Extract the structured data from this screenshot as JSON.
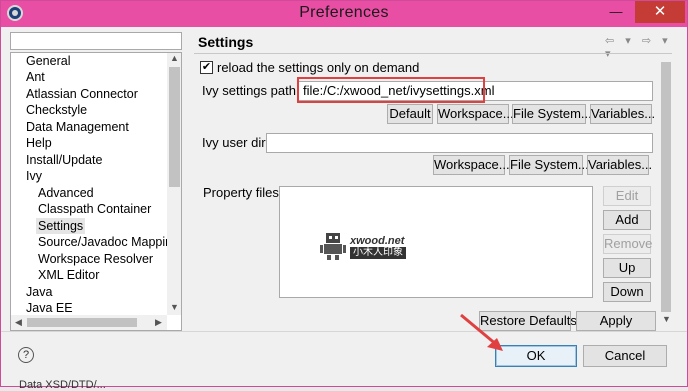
{
  "window": {
    "title": "Preferences"
  },
  "titlebar": {
    "minimize": "—",
    "close": "✕"
  },
  "tree": {
    "items": [
      {
        "label": "General",
        "selected": false
      },
      {
        "label": "Ant",
        "selected": false
      },
      {
        "label": "Atlassian Connector",
        "selected": false
      },
      {
        "label": "Checkstyle",
        "selected": false
      },
      {
        "label": "Data Management",
        "selected": false
      },
      {
        "label": "Help",
        "selected": false
      },
      {
        "label": "Install/Update",
        "selected": false
      },
      {
        "label": "Ivy",
        "selected": false
      },
      {
        "label": "Advanced",
        "selected": false
      },
      {
        "label": "Classpath Container",
        "selected": false
      },
      {
        "label": "Settings",
        "selected": true
      },
      {
        "label": "Source/Javadoc Mapping",
        "selected": false
      },
      {
        "label": "Workspace Resolver",
        "selected": false
      },
      {
        "label": "XML Editor",
        "selected": false
      },
      {
        "label": "Java",
        "selected": false
      },
      {
        "label": "Java EE",
        "selected": false
      }
    ]
  },
  "page": {
    "title": "Settings",
    "nav_arrows": "⇦ ▾ ⇨ ▾ ▾",
    "reload_checkbox": {
      "checked": true,
      "mark": "✔",
      "label": "reload the settings only on demand"
    },
    "ivy_settings_path": {
      "label": "Ivy settings path:",
      "value": "file:/C:/xwood_net/ivysettings.xml"
    },
    "settings_buttons": {
      "default": "Default",
      "workspace": "Workspace...",
      "file_system": "File System...",
      "variables": "Variables..."
    },
    "ivy_user_dir": {
      "label": "Ivy user dir:",
      "value": ""
    },
    "user_dir_buttons": {
      "workspace": "Workspace...",
      "file_system": "File System...",
      "variables": "Variables..."
    },
    "property_files": {
      "label": "Property files:"
    },
    "watermark": {
      "title": "xwood.net",
      "subtitle": "小木人印象"
    },
    "property_buttons": {
      "edit": "Edit",
      "add": "Add",
      "remove": "Remove",
      "up": "Up",
      "down": "Down"
    },
    "restore_defaults": "Restore Defaults",
    "apply": "Apply"
  },
  "footer": {
    "help": "?",
    "ok": "OK",
    "cancel": "Cancel"
  },
  "under_text": "Data XSD/DTD/...",
  "colors": {
    "titlebar": "#e84ea4",
    "highlight": "#e04040",
    "arrow": "#e04040"
  }
}
